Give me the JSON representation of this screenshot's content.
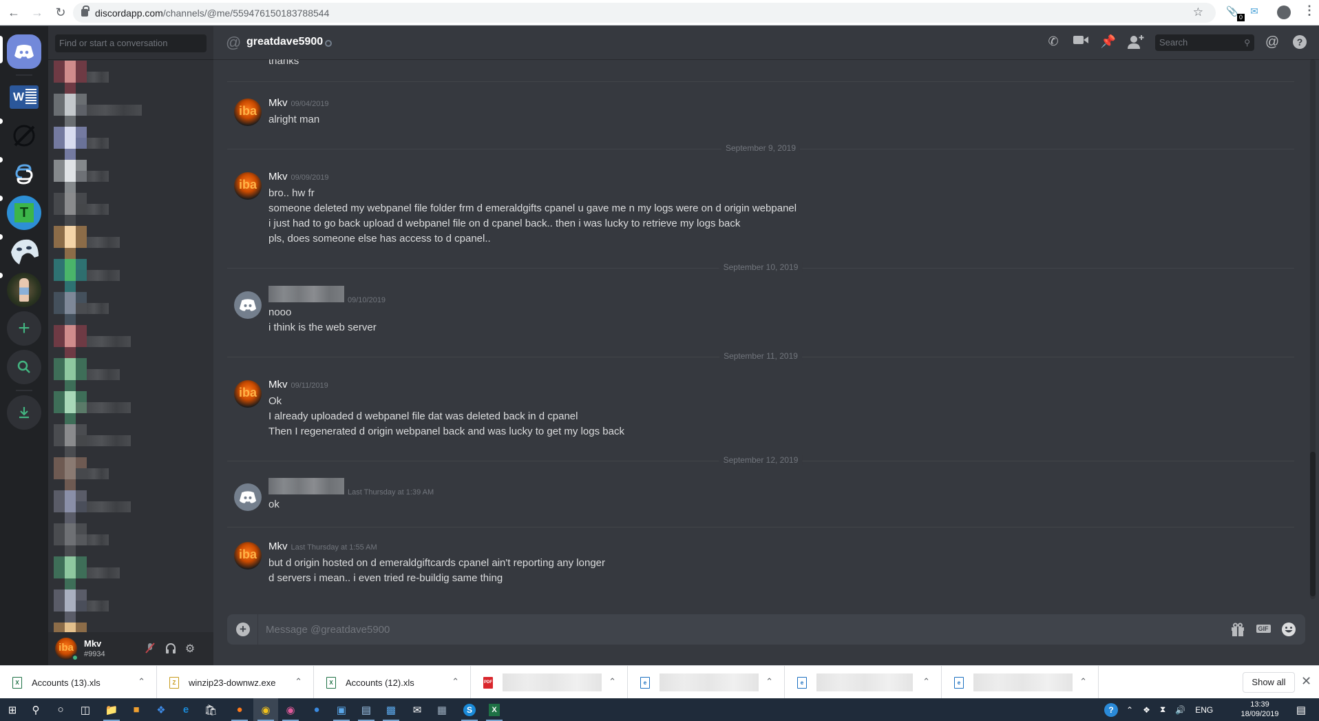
{
  "browser": {
    "url_host": "discordapp.com",
    "url_path": "/channels/@me/559476150183788544",
    "extension_badge": "0"
  },
  "sidebar": {
    "search_placeholder": "Find or start a conversation",
    "guilds": [
      {
        "name": "home",
        "icon": "discord-logo-icon"
      },
      {
        "name": "word-server",
        "icon": "word-icon"
      },
      {
        "name": "slash-server",
        "icon": "slash-circle-icon"
      },
      {
        "name": "link-server",
        "icon": "cloud-link-icon"
      },
      {
        "name": "t-server",
        "icon": "letter-t-icon",
        "label": "T"
      },
      {
        "name": "mask-server",
        "icon": "mask-icon"
      },
      {
        "name": "photo-server",
        "icon": "photo-avatar-icon"
      }
    ],
    "add_server_icon": "plus-icon",
    "explore_icon": "search-icon",
    "download_icon": "download-icon"
  },
  "user_panel": {
    "username": "Mkv",
    "tag": "#9934",
    "avatar_text": "iba",
    "status_color": "#43b581"
  },
  "header": {
    "title": "greatdave5900",
    "search_placeholder": "Search"
  },
  "messages": {
    "top_fragment": "thanks",
    "groups": [
      {
        "author": "Mkv",
        "time": "09/04/2019",
        "lines": [
          "alright man"
        ]
      },
      {
        "date_divider": "September 9, 2019",
        "author": "Mkv",
        "time": "09/09/2019",
        "lines": [
          "bro.. hw fr",
          "someone deleted my webpanel file folder frm d emeraldgifts cpanel u gave me n my logs were on d origin webpanel",
          "i just had to go back upload d webpanel file on d cpanel back.. then i was lucky to retrieve my logs back",
          "pls, does someone else has access to d cpanel.."
        ]
      },
      {
        "date_divider": "September 10, 2019",
        "author": "",
        "author_blurred": true,
        "time": "09/10/2019",
        "lines": [
          "nooo",
          "i think is the web server"
        ]
      },
      {
        "date_divider": "September 11, 2019",
        "author": "Mkv",
        "time": "09/11/2019",
        "lines": [
          "Ok",
          "I already uploaded d webpanel file dat was deleted back in d cpanel",
          "Then I regenerated d origin webpanel back and was lucky to get my logs back"
        ]
      },
      {
        "date_divider": "September 12, 2019",
        "author": "",
        "author_blurred": true,
        "time": "Last Thursday at 1:39 AM",
        "lines": [
          "ok"
        ]
      },
      {
        "author": "Mkv",
        "time": "Last Thursday at 1:55 AM",
        "lines": [
          "but d origin hosted on d emeraldgiftcards cpanel ain't reporting any longer",
          "d servers i mean.. i even tried re-buildig same thing"
        ]
      }
    ]
  },
  "composer": {
    "placeholder": "Message @greatdave5900",
    "gif_label": "GIF"
  },
  "downloads": {
    "items": [
      {
        "name": "Accounts (13).xls",
        "type": "excel"
      },
      {
        "name": "winzip23-downwz.exe",
        "type": "exe"
      },
      {
        "name": "Accounts (12).xls",
        "type": "excel"
      },
      {
        "name": "",
        "type": "pdf",
        "blurred": true
      },
      {
        "name": "",
        "type": "ie",
        "blurred": true
      },
      {
        "name": "",
        "type": "ie",
        "blurred": true
      },
      {
        "name": "",
        "type": "ie",
        "blurred": true
      }
    ],
    "show_all_label": "Show all",
    "pdf_label": "PDF"
  },
  "taskbar": {
    "language": "ENG",
    "time": "13:39",
    "date": "18/09/2019"
  }
}
